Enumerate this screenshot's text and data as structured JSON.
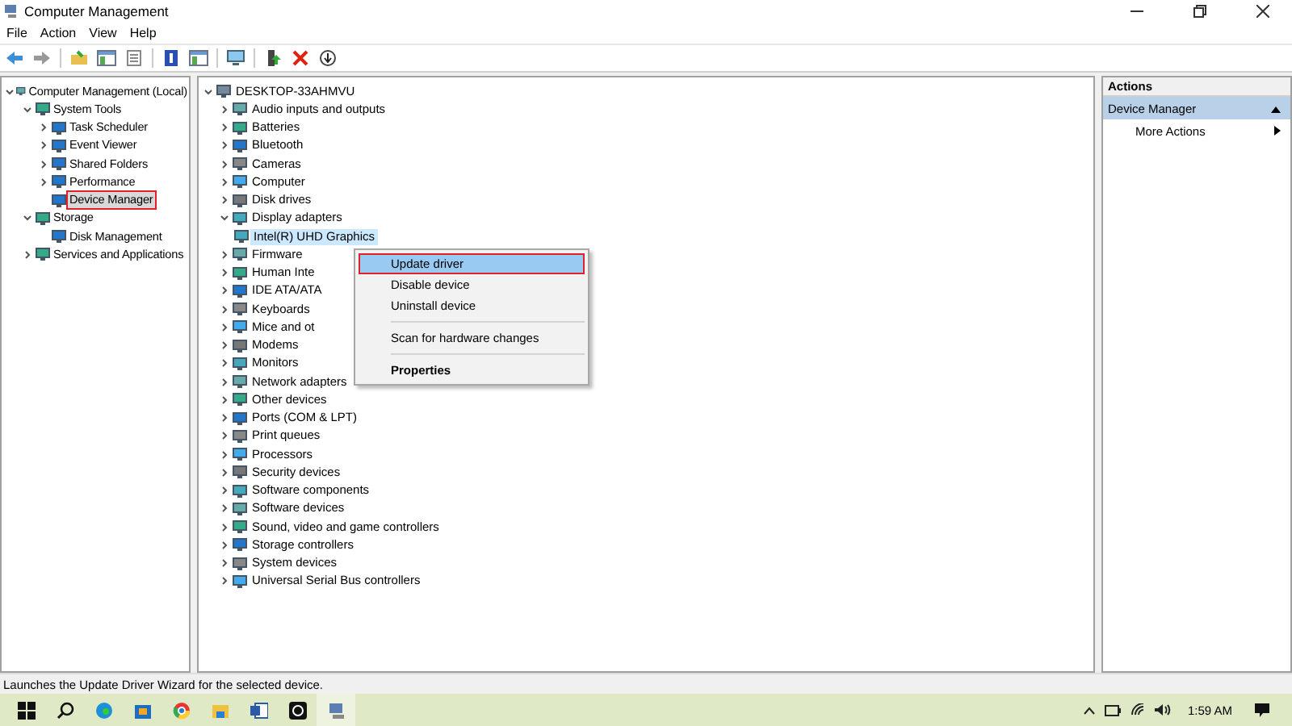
{
  "window": {
    "title": "Computer Management"
  },
  "menu": [
    "File",
    "Action",
    "View",
    "Help"
  ],
  "left_tree": [
    {
      "label": "Computer Management (Local)",
      "expanded": true,
      "selected": false,
      "marked": false,
      "children": [
        {
          "label": "System Tools",
          "expanded": true,
          "selected": false,
          "marked": false,
          "children": [
            {
              "label": "Task Scheduler",
              "expanded": false,
              "selected": false,
              "marked": false
            },
            {
              "label": "Event Viewer",
              "expanded": false,
              "selected": false,
              "marked": false
            },
            {
              "label": "Shared Folders",
              "expanded": false,
              "selected": false,
              "marked": false
            },
            {
              "label": "Performance",
              "expanded": false,
              "selected": false,
              "marked": false
            },
            {
              "label": "Device Manager",
              "selected": true,
              "marked": true
            }
          ]
        },
        {
          "label": "Storage",
          "expanded": true,
          "selected": false,
          "marked": false,
          "children": [
            {
              "label": "Disk Management",
              "selected": false,
              "marked": false
            }
          ]
        },
        {
          "label": "Services and Applications",
          "expanded": false,
          "selected": false,
          "marked": false
        }
      ]
    }
  ],
  "device_tree": {
    "root": "DESKTOP-33AHMVU",
    "items": [
      {
        "label": "Audio inputs and outputs",
        "expanded": false
      },
      {
        "label": "Batteries",
        "expanded": false
      },
      {
        "label": "Bluetooth",
        "expanded": false
      },
      {
        "label": "Cameras",
        "expanded": false
      },
      {
        "label": "Computer",
        "expanded": false
      },
      {
        "label": "Disk drives",
        "expanded": false
      },
      {
        "label": "Display adapters",
        "expanded": true,
        "children": [
          {
            "label": "Intel(R) UHD Graphics",
            "selected": true
          }
        ]
      },
      {
        "label": "Firmware",
        "expanded": false
      },
      {
        "label": "Human Inte",
        "expanded": false
      },
      {
        "label": "IDE ATA/ATA",
        "expanded": false
      },
      {
        "label": "Keyboards",
        "expanded": false
      },
      {
        "label": "Mice and ot",
        "expanded": false
      },
      {
        "label": "Modems",
        "expanded": false
      },
      {
        "label": "Monitors",
        "expanded": false
      },
      {
        "label": "Network adapters",
        "expanded": false
      },
      {
        "label": "Other devices",
        "expanded": false
      },
      {
        "label": "Ports (COM & LPT)",
        "expanded": false
      },
      {
        "label": "Print queues",
        "expanded": false
      },
      {
        "label": "Processors",
        "expanded": false
      },
      {
        "label": "Security devices",
        "expanded": false
      },
      {
        "label": "Software components",
        "expanded": false
      },
      {
        "label": "Software devices",
        "expanded": false
      },
      {
        "label": "Sound, video and game controllers",
        "expanded": false
      },
      {
        "label": "Storage controllers",
        "expanded": false
      },
      {
        "label": "System devices",
        "expanded": false
      },
      {
        "label": "Universal Serial Bus controllers",
        "expanded": false
      }
    ]
  },
  "context_menu": [
    {
      "kind": "item",
      "label": "Update driver",
      "selected": true,
      "marked": true,
      "bold": false
    },
    {
      "kind": "item",
      "label": "Disable device",
      "selected": false,
      "marked": false,
      "bold": false
    },
    {
      "kind": "item",
      "label": "Uninstall device",
      "selected": false,
      "marked": false,
      "bold": false
    },
    {
      "kind": "separator"
    },
    {
      "kind": "item",
      "label": "Scan for hardware changes",
      "selected": false,
      "marked": false,
      "bold": false
    },
    {
      "kind": "separator"
    },
    {
      "kind": "item",
      "label": "Properties",
      "selected": false,
      "marked": false,
      "bold": true
    }
  ],
  "actions": {
    "title": "Actions",
    "section": "Device Manager",
    "items": [
      "More Actions"
    ]
  },
  "status_bar": "Launches the Update Driver Wizard for the selected device.",
  "taskbar": {
    "clock": "1:59 AM"
  }
}
